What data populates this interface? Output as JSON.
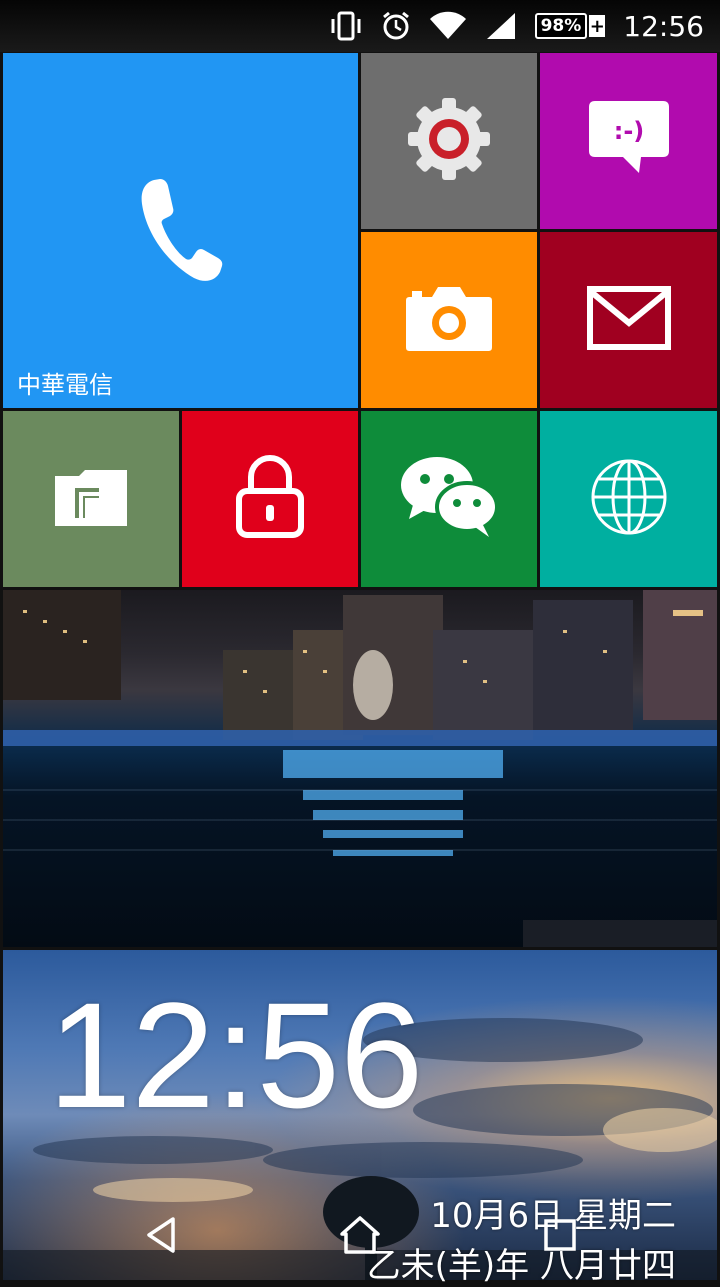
{
  "status_bar": {
    "battery_percent": "98%",
    "battery_plus": "+",
    "time": "12:56",
    "icons": [
      "vibrate-icon",
      "alarm-icon",
      "wifi-icon",
      "signal-icon",
      "battery-icon"
    ]
  },
  "tiles": {
    "phone": {
      "label": "中華電信",
      "color": "#2196F3"
    },
    "settings": {
      "color": "#6E6E6E"
    },
    "messaging": {
      "face": ":-)",
      "color": "#B10BAE"
    },
    "camera": {
      "color": "#FF8C00"
    },
    "mail": {
      "color": "#A00020"
    },
    "files": {
      "color": "#6B8A5E"
    },
    "lock": {
      "color": "#E0001B"
    },
    "wechat": {
      "color": "#0E8C3A"
    },
    "browser": {
      "color": "#00AFA0"
    }
  },
  "clock_widget": {
    "time": "12:56",
    "date": "10月6日 星期二",
    "lunar_date": "乙未(羊)年 八月廿四"
  },
  "nav_bar": {
    "icons": [
      "back-icon",
      "home-icon",
      "recents-icon"
    ]
  }
}
